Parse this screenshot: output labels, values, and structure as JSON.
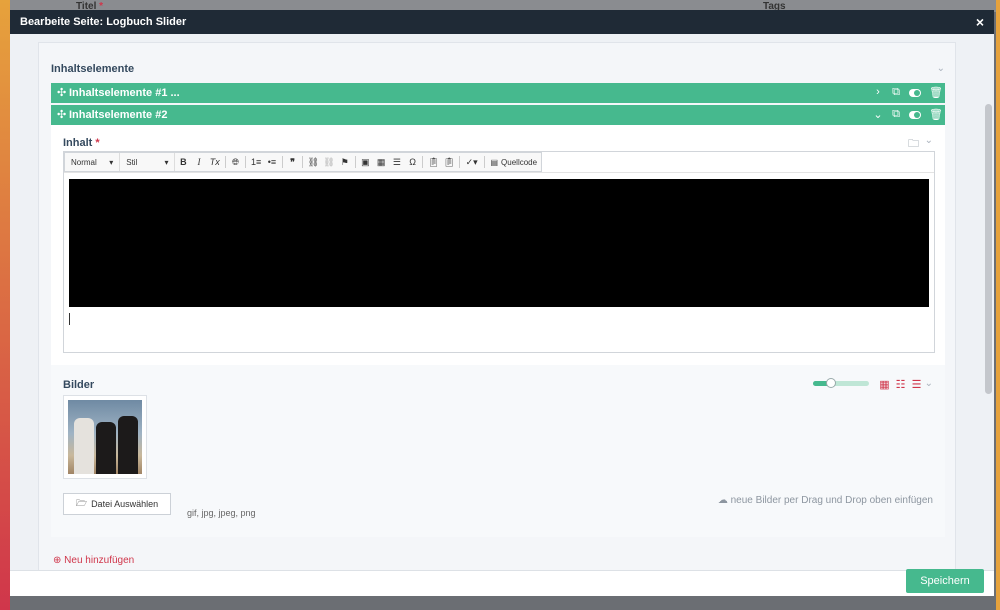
{
  "background": {
    "titel_label": "Titel",
    "titel_required": "*",
    "tags_label": "Tags"
  },
  "modal": {
    "title": "Bearbeite Seite: Logbuch Slider",
    "close_label": "×"
  },
  "section": {
    "title": "Inhaltselemente"
  },
  "elements": [
    {
      "label": "Inhaltselemente #1 ...",
      "chevron": "›"
    },
    {
      "label": "Inhaltselemente #2",
      "chevron": "⌄"
    }
  ],
  "inhalt": {
    "label": "Inhalt",
    "required": "*"
  },
  "toolbar": {
    "format_select": "Normal",
    "style_select": "Stil",
    "bold": "B",
    "italic": "I",
    "remove_format": "Tx",
    "numbered_list": "1≡",
    "bulleted_list": "•≡",
    "blockquote": "❞",
    "source_label": "Quellcode"
  },
  "bilder": {
    "label": "Bilder",
    "slider_value": 0.33,
    "choose_file_label": "Datei Auswählen",
    "file_types": "gif, jpg, jpeg, png",
    "drag_drop_hint": "neue Bilder per Drag und Drop oben einfügen"
  },
  "add_new_label": "Neu hinzufügen",
  "save_label": "Speichern",
  "colors": {
    "accent": "#46b98e",
    "danger": "#d0364b",
    "header": "#1f2a36"
  }
}
